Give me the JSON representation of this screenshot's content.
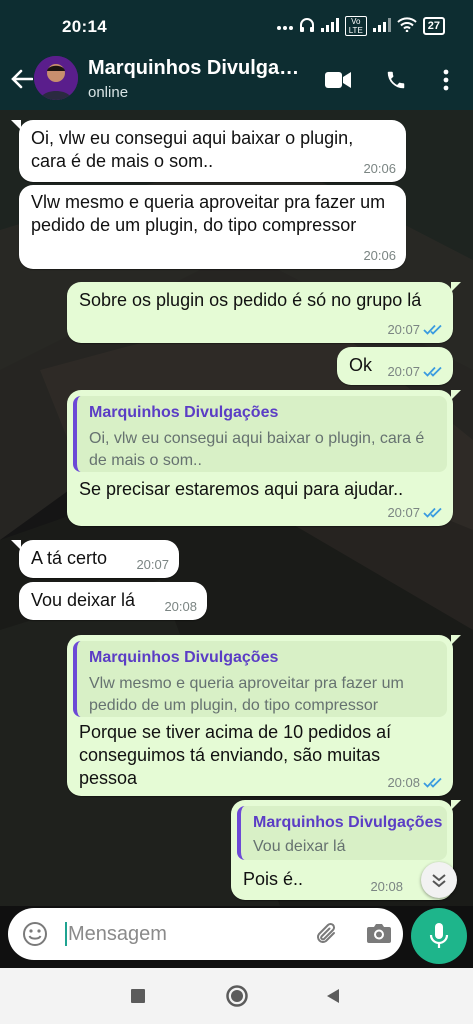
{
  "status_bar": {
    "time": "20:14",
    "icons": [
      "more-dots-icon",
      "headset-icon",
      "signal-icon",
      "volte-icon",
      "signal-icon",
      "wifi-icon"
    ],
    "volte_label": "Vo LTE",
    "battery": "27"
  },
  "header": {
    "contact_name": "Marquinhos Divulgações",
    "status": "online",
    "header_color": "#0d2d31"
  },
  "messages": [
    {
      "dir": "in",
      "text": "Oi, vlw eu consegui aqui baixar o plugin, cara é de mais o som..",
      "time": "20:06"
    },
    {
      "dir": "in",
      "text": "Vlw mesmo e queria aproveitar pra fazer um pedido de um plugin, do tipo compressor",
      "time": "20:06"
    },
    {
      "dir": "out",
      "text": "Sobre os plugin os pedido é só no grupo lá",
      "time": "20:07",
      "read": true
    },
    {
      "dir": "out",
      "text": "Ok",
      "time": "20:07",
      "read": true
    },
    {
      "dir": "out",
      "quote_name": "Marquinhos Divulgações",
      "quote_text": "Oi, vlw eu consegui aqui baixar o plugin, cara é de mais o som..",
      "text": "Se precisar estaremos aqui para ajudar..",
      "time": "20:07",
      "read": true
    },
    {
      "dir": "in",
      "text": "A tá certo",
      "time": "20:07"
    },
    {
      "dir": "in",
      "text": "Vou deixar lá",
      "time": "20:08"
    },
    {
      "dir": "out",
      "quote_name": "Marquinhos Divulgações",
      "quote_text": "Vlw mesmo e queria aproveitar pra fazer um pedido de um plugin, do tipo compressor",
      "text": "Porque se tiver acima de 10 pedidos aí conseguimos tá enviando, são muitas pessoa",
      "time": "20:08",
      "read": true
    },
    {
      "dir": "out",
      "quote_name": "Marquinhos Divulgações",
      "quote_text": "Vou deixar lá",
      "text": "Pois é..",
      "time": "20:08",
      "read": true
    }
  ],
  "input": {
    "placeholder": "Mensagem"
  },
  "colors": {
    "outgoing_bubble": "#e5fbd5",
    "incoming_bubble": "#ffffff",
    "quote_name": "#5b3dc5",
    "read_ticks": "#3a9be0",
    "mic_button": "#1eb58b"
  }
}
